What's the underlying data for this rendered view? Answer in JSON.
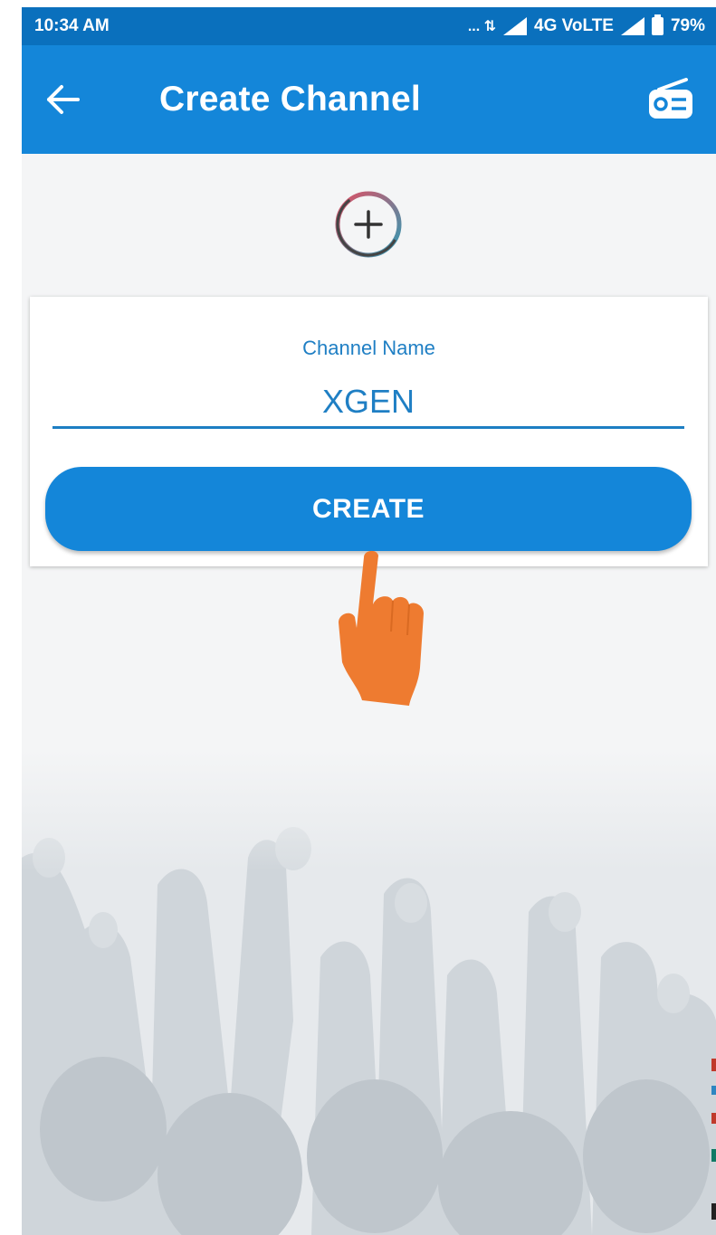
{
  "status_bar": {
    "time": "10:34 AM",
    "network": "... ⇅",
    "carrier": "4G VoLTE",
    "battery": "79%"
  },
  "app_bar": {
    "title": "Create Channel",
    "back_icon": "arrow-left-icon",
    "action_icon": "radio-icon"
  },
  "form": {
    "field_label": "Channel Name",
    "channel_name_value": "XGEN",
    "create_label": "CREATE"
  },
  "colors": {
    "primary": "#1486d9",
    "status_bar": "#0a70bd",
    "accent_text": "#1f7fc4",
    "pointer": "#ee7b30"
  }
}
